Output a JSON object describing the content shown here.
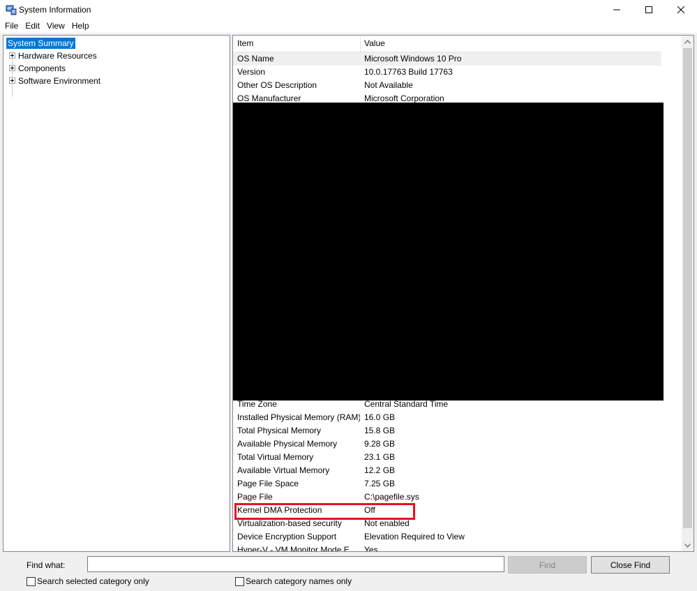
{
  "window": {
    "title": "System Information",
    "controls": {
      "minimize": "—",
      "maximize": "☐",
      "close": "✕"
    }
  },
  "menu": [
    "File",
    "Edit",
    "View",
    "Help"
  ],
  "tree": {
    "selected": "System Summary",
    "children": [
      "Hardware Resources",
      "Components",
      "Software Environment"
    ]
  },
  "list": {
    "columns": {
      "item": "Item",
      "value": "Value"
    },
    "rows_top": [
      {
        "item": "OS Name",
        "value": "Microsoft Windows 10 Pro"
      },
      {
        "item": "Version",
        "value": "10.0.17763 Build 17763"
      },
      {
        "item": "Other OS Description",
        "value": "Not Available"
      },
      {
        "item": "OS Manufacturer",
        "value": "Microsoft Corporation"
      }
    ],
    "rows_bottom": [
      {
        "item": "Time Zone",
        "value": "Central Standard Time"
      },
      {
        "item": "Installed Physical Memory (RAM)",
        "value": "16.0 GB"
      },
      {
        "item": "Total Physical Memory",
        "value": "15.8 GB"
      },
      {
        "item": "Available Physical Memory",
        "value": "9.28 GB"
      },
      {
        "item": "Total Virtual Memory",
        "value": "23.1 GB"
      },
      {
        "item": "Available Virtual Memory",
        "value": "12.2 GB"
      },
      {
        "item": "Page File Space",
        "value": "7.25 GB"
      },
      {
        "item": "Page File",
        "value": "C:\\pagefile.sys"
      },
      {
        "item": "Kernel DMA Protection",
        "value": "Off"
      },
      {
        "item": "Virtualization-based security",
        "value": "Not enabled"
      },
      {
        "item": "Device Encryption Support",
        "value": "Elevation Required to View"
      },
      {
        "item": "Hyper-V - VM Monitor Mode E...",
        "value": "Yes"
      }
    ]
  },
  "find": {
    "label": "Find what:",
    "value": "",
    "find_button": "Find",
    "close_button": "Close Find",
    "check_selected": "Search selected category only",
    "check_names": "Search category names only"
  },
  "colors": {
    "selection": "#0078d7",
    "highlight_box": "#e81123",
    "redaction": "#000000"
  }
}
